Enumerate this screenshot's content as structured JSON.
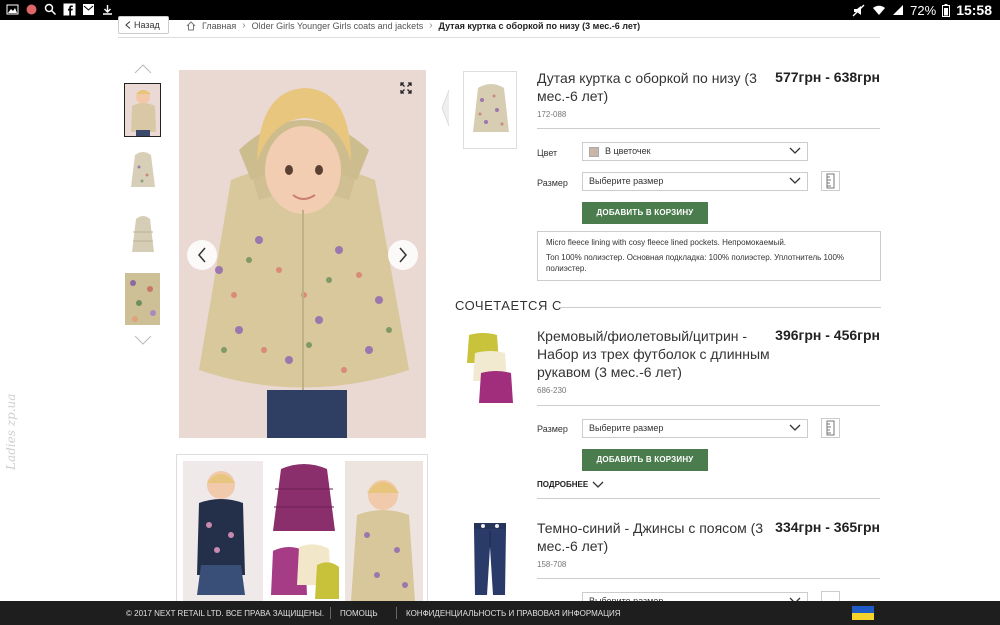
{
  "statusbar": {
    "battery": "72%",
    "time": "15:58"
  },
  "breadcrumb": {
    "back": "Назад",
    "items": [
      "Главная",
      "Older Girls Younger Girls coats and jackets",
      "Дутая куртка с оборкой по низу (3 мес.-6 лет)"
    ]
  },
  "product": {
    "title": "Дутая куртка с оборкой по низу (3 мес.-6 лет)",
    "price": "577грн - 638грн",
    "code": "172-088",
    "color_label": "Цвет",
    "color_value": "В цветочек",
    "size_label": "Размер",
    "size_placeholder": "Выберите размер",
    "add_to_cart": "ДОБАВИТЬ В КОРЗИНУ",
    "desc_1": "Micro fleece lining with cosy fleece lined pockets. Непромокаемый.",
    "desc_2": "Топ 100% полиэстер. Основная подкладка: 100% полиэстер. Уплотнитель 100% полиэстер."
  },
  "complements": {
    "title": "СОЧЕТАЕТСЯ С",
    "items": [
      {
        "title": "Кремовый/фиолетовый/цитрин - Набор из трех футболок с длинным рукавом (3 мес.-6 лет)",
        "price": "396грн - 456грн",
        "code": "686-230",
        "size_label": "Размер",
        "size_placeholder": "Выберите размер",
        "add_to_cart": "ДОБАВИТЬ В КОРЗИНУ",
        "more": "ПОДРОБНЕЕ"
      },
      {
        "title": "Темно-синий - Джинсы с поясом (3 мес.-6 лет)",
        "price": "334грн - 365грн",
        "code": "158-708",
        "size_placeholder": "Выберите размер"
      }
    ]
  },
  "footer": {
    "copyright": "© 2017 NEXT RETAIL LTD. ВСЕ ПРАВА ЗАЩИЩЕНЫ.",
    "help": "ПОМОЩЬ",
    "privacy": "КОНФИДЕНЦИАЛЬНОСТЬ И ПРАВОВАЯ ИНФОРМАЦИЯ"
  },
  "watermark": "Ladies zp.ua",
  "colors": {
    "accent_green": "#4a7c4e",
    "footer_bg": "#1e1e1e"
  }
}
